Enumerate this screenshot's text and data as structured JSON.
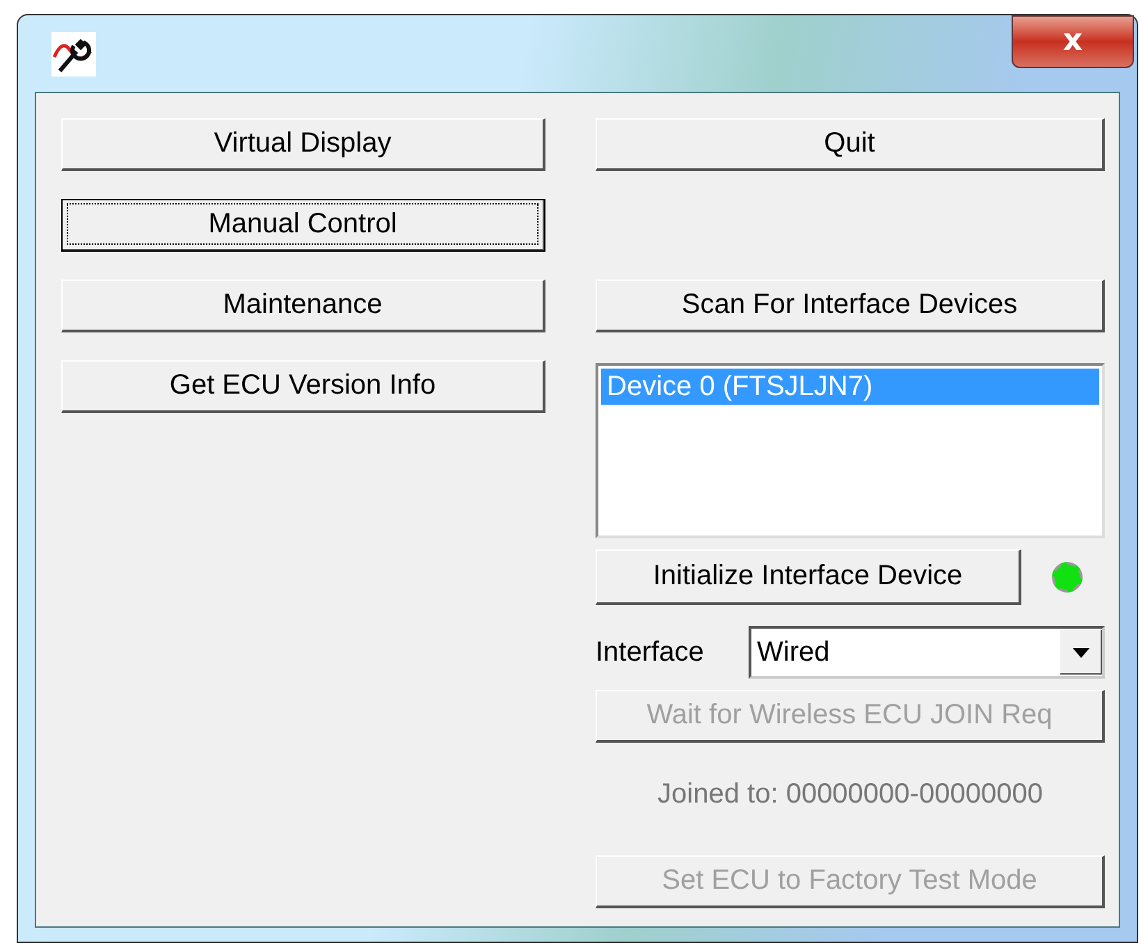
{
  "window": {
    "close_label": "x"
  },
  "left_buttons": [
    {
      "label": "Virtual Display",
      "focused": false
    },
    {
      "label": "Manual Control",
      "focused": true
    },
    {
      "label": "Maintenance",
      "focused": false
    },
    {
      "label": "Get ECU Version Info",
      "focused": false
    }
  ],
  "quit_button": {
    "label": "Quit"
  },
  "scan_button": {
    "label": "Scan For Interface Devices"
  },
  "device_list": [
    {
      "label": "Device 0 (FTSJLJN7)",
      "selected": true
    }
  ],
  "init_button": {
    "label": "Initialize Interface Device"
  },
  "status_led": {
    "on": true
  },
  "interface": {
    "label": "Interface",
    "value": "Wired"
  },
  "wait_button": {
    "label": "Wait for Wireless ECU JOIN Req",
    "disabled": true
  },
  "joined_text": "Joined to: 00000000-00000000",
  "factory_button": {
    "label": "Set ECU to Factory Test Mode",
    "disabled": true
  }
}
